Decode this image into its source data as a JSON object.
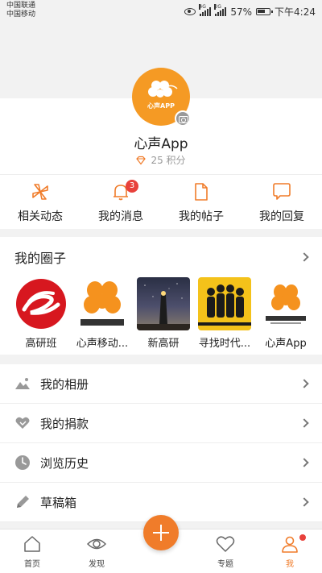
{
  "status_bar": {
    "carrier1": "中国联通",
    "carrier2": "中国移动",
    "net1": "4G",
    "net2": "2G",
    "battery": "57%",
    "time": "下午4:24"
  },
  "profile": {
    "avatar_text": "心声APP",
    "name": "心声App",
    "points": "25 积分"
  },
  "actions": [
    {
      "label": "相关动态",
      "icon": "pinwheel-icon"
    },
    {
      "label": "我的消息",
      "icon": "bell-icon",
      "badge": "3"
    },
    {
      "label": "我的帖子",
      "icon": "document-icon"
    },
    {
      "label": "我的回复",
      "icon": "chat-bubble-icon"
    }
  ],
  "circles": {
    "title": "我的圈子",
    "items": [
      {
        "label": "高研班"
      },
      {
        "label": "心声移动..."
      },
      {
        "label": "新高研"
      },
      {
        "label": "寻找时代..."
      },
      {
        "label": "心声App"
      }
    ]
  },
  "menu": [
    {
      "label": "我的相册",
      "icon": "photo-icon"
    },
    {
      "label": "我的捐款",
      "icon": "handshake-heart-icon"
    },
    {
      "label": "浏览历史",
      "icon": "clock-icon"
    },
    {
      "label": "草稿箱",
      "icon": "pencil-icon"
    }
  ],
  "bottom_nav": [
    {
      "label": "首页",
      "icon": "home-icon"
    },
    {
      "label": "发现",
      "icon": "eye-icon"
    },
    {
      "label": "",
      "icon": "plus-icon"
    },
    {
      "label": "专题",
      "icon": "heart-icon"
    },
    {
      "label": "我",
      "icon": "person-icon"
    }
  ],
  "colors": {
    "accent": "#f07c2a",
    "badge": "#e8413b",
    "background": "#f2f2f2"
  }
}
